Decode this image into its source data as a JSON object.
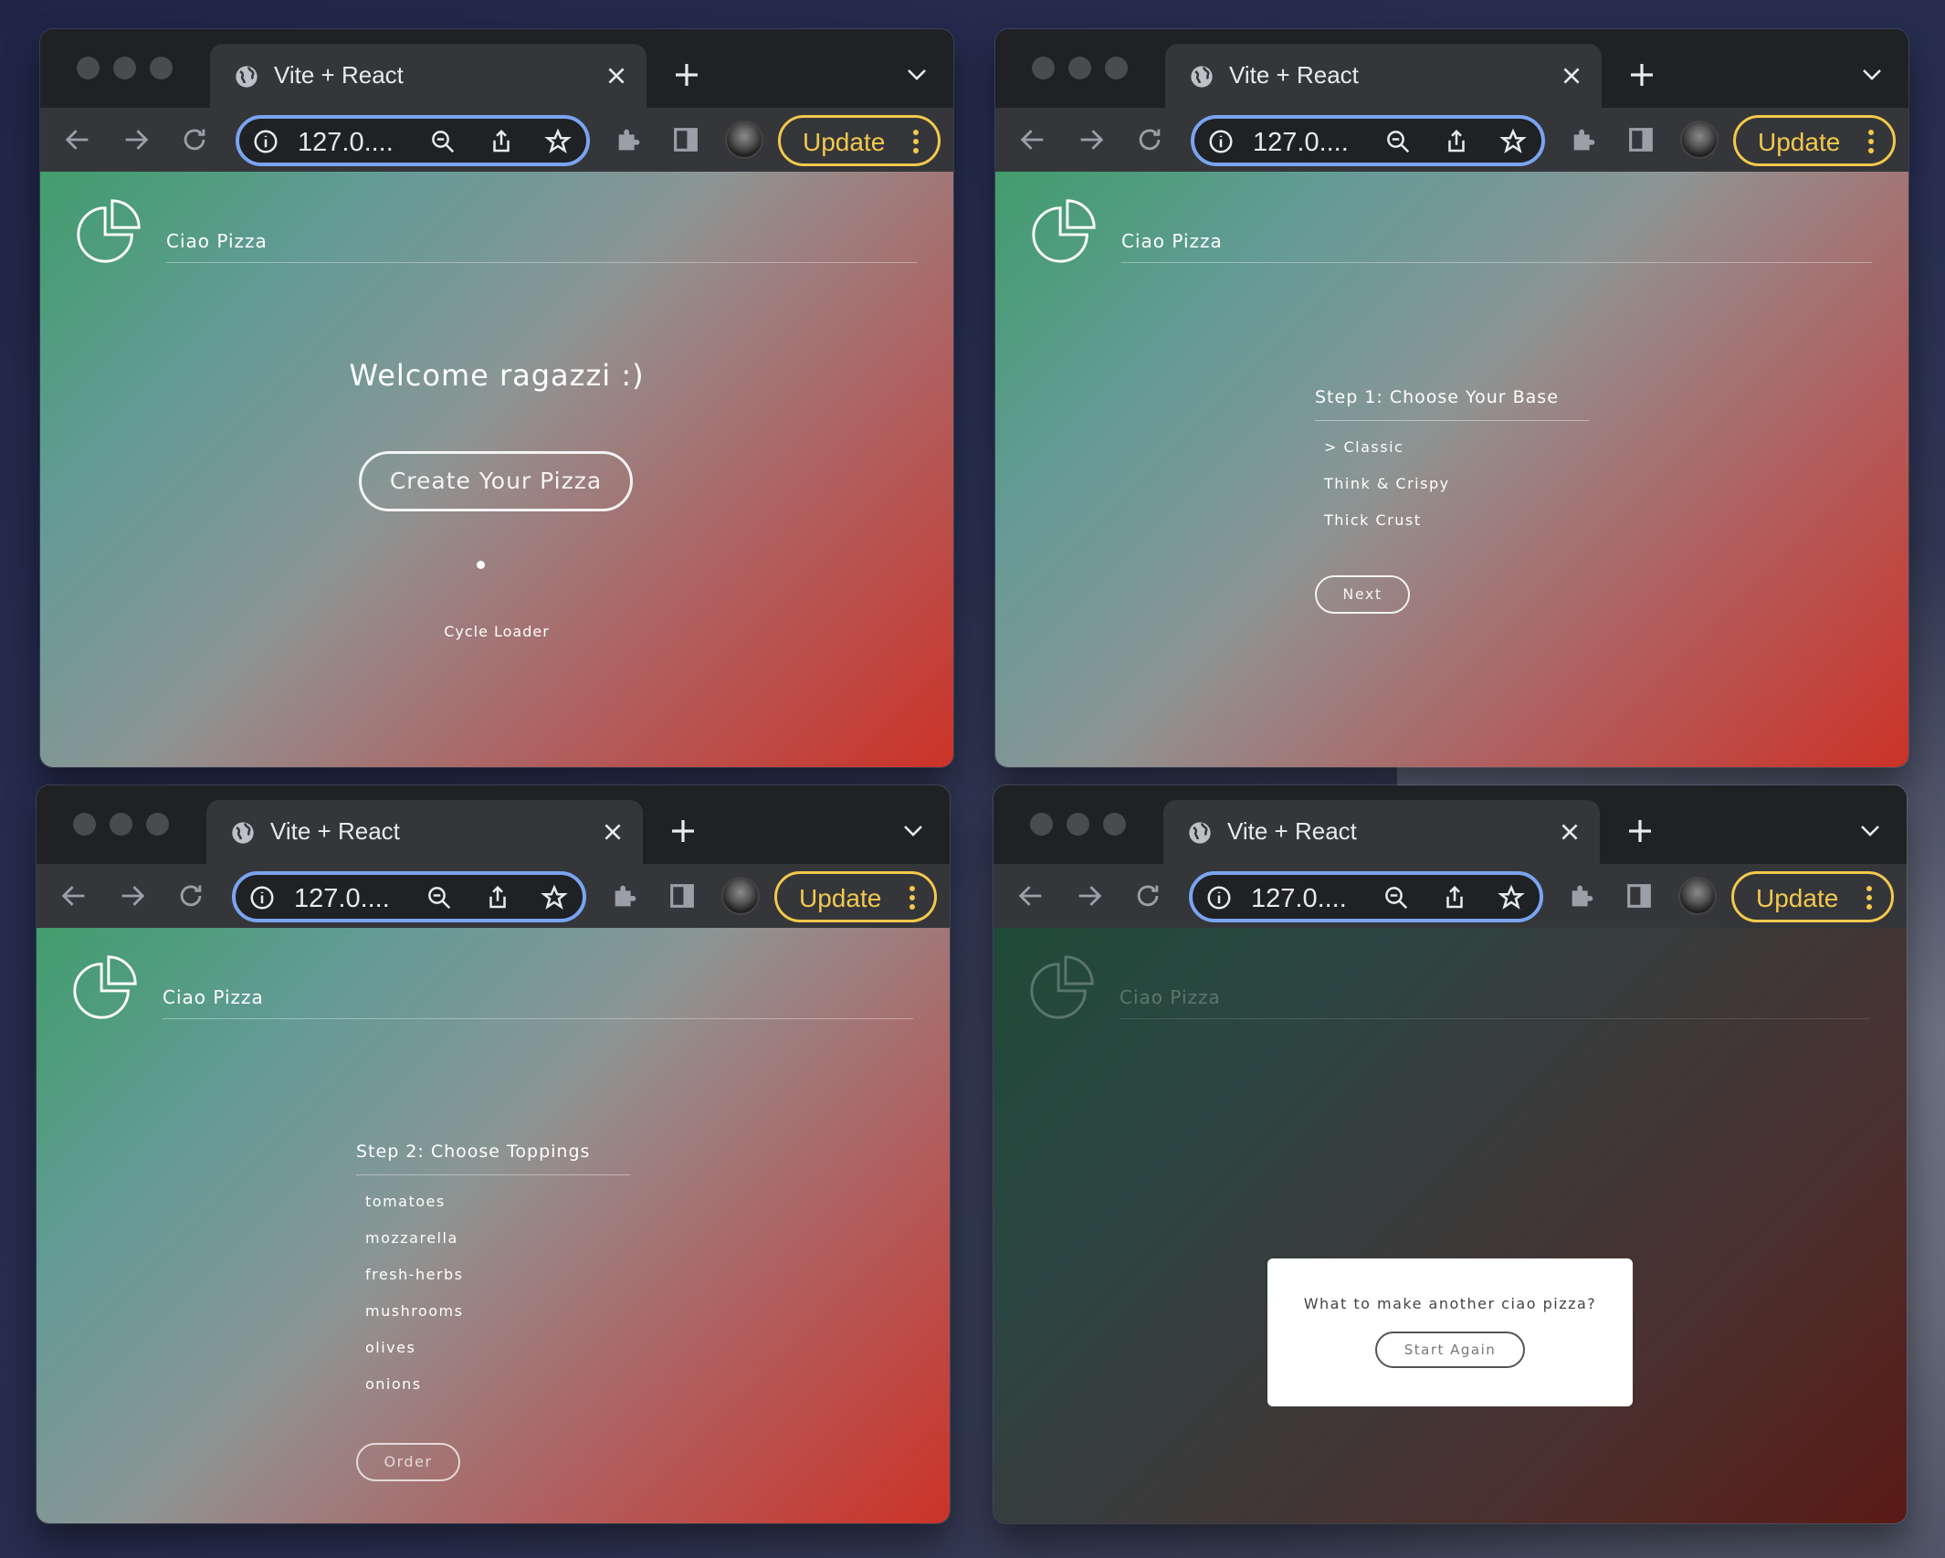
{
  "browser": {
    "tab_title": "Vite + React",
    "url": "127.0....",
    "update_label": "Update"
  },
  "app": {
    "brand": "Ciao Pizza"
  },
  "screen1": {
    "welcome": "Welcome ragazzi :)",
    "create_button": "Create Your Pizza",
    "loader_label": "Cycle Loader"
  },
  "screen2": {
    "step_title": "Step 1: Choose Your Base",
    "options": [
      "> Classic",
      "Think & Crispy",
      "Thick Crust"
    ],
    "next_button": "Next"
  },
  "screen3": {
    "step_title": "Step 2: Choose Toppings",
    "toppings": [
      "tomatoes",
      "mozzarella",
      "fresh-herbs",
      "mushrooms",
      "olives",
      "onions"
    ],
    "order_button": "Order"
  },
  "screen4": {
    "modal_question": "What to make another ciao pizza?",
    "start_again_button": "Start Again"
  },
  "colors": {
    "omnibox_border": "#7aa4f0",
    "update_accent": "#f2c94c",
    "gradient_green": "#4a9a78",
    "gradient_red": "#cc3328"
  }
}
